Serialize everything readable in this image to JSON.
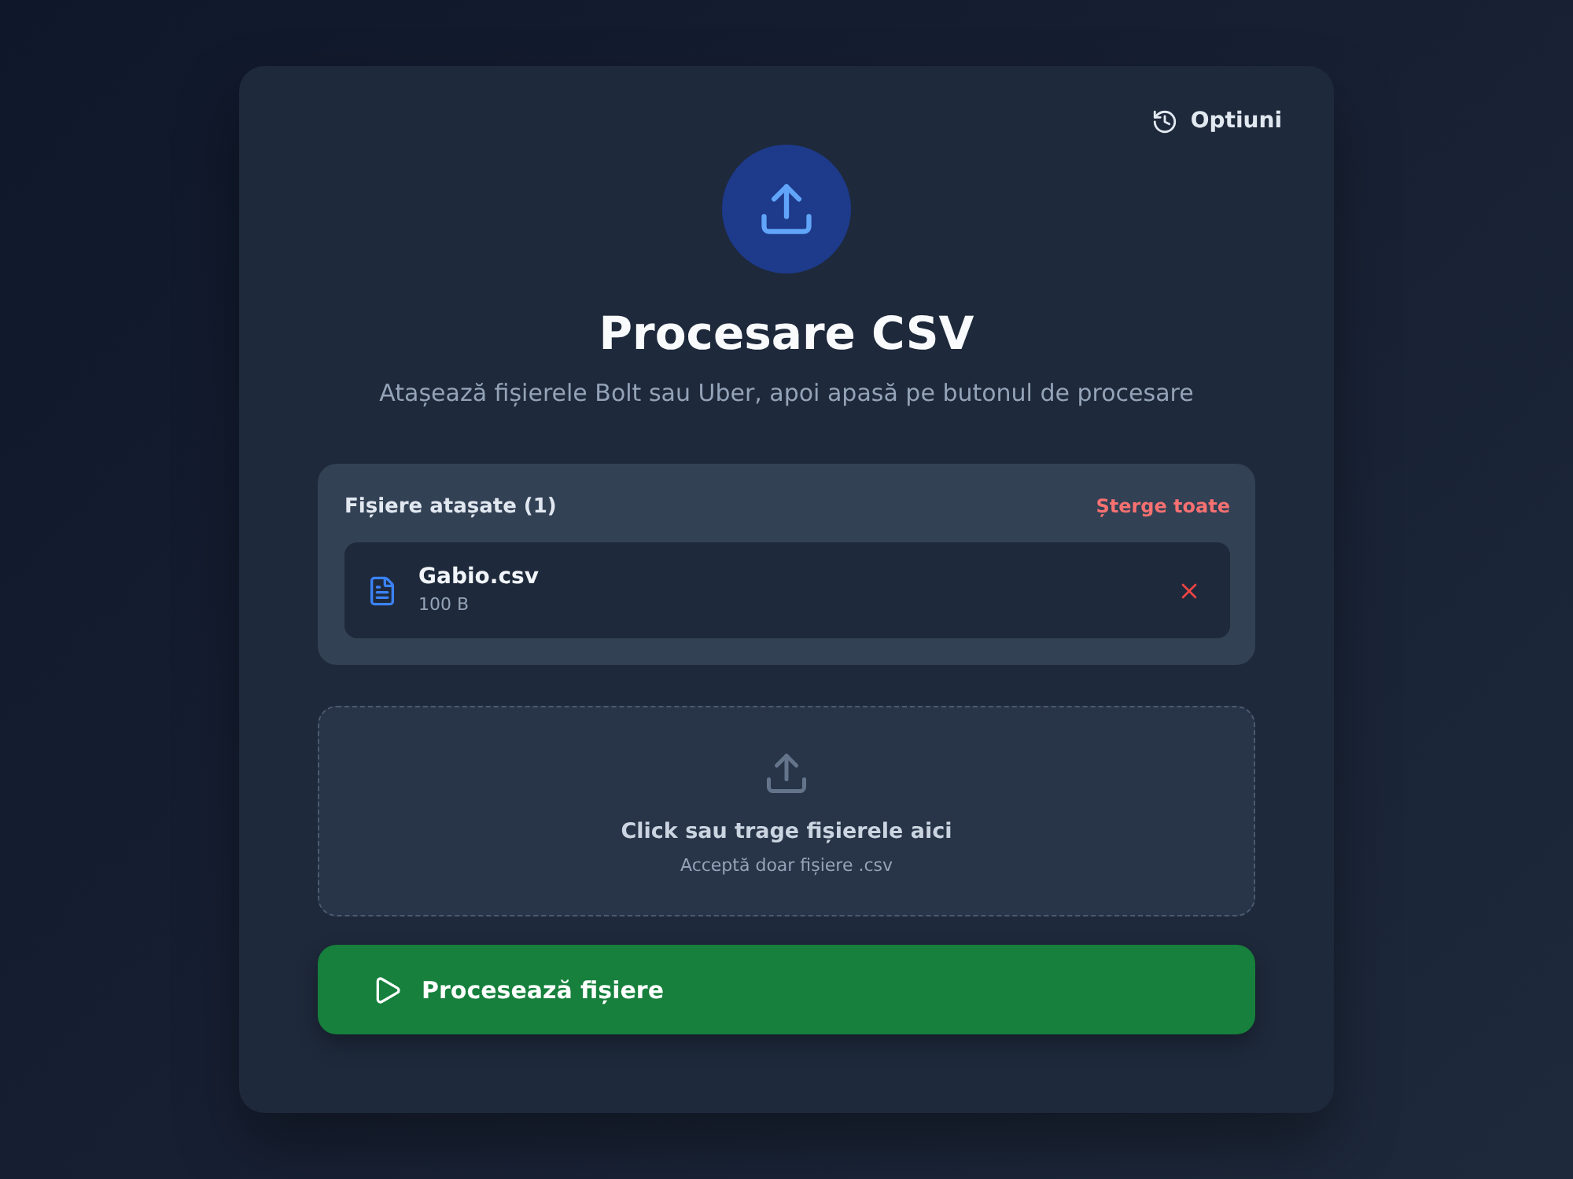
{
  "options_button": {
    "label": "Optiuni"
  },
  "header": {
    "title": "Procesare CSV",
    "subtitle": "Atașează fișierele Bolt sau Uber, apoi apasă pe butonul de procesare"
  },
  "attached_files": {
    "title": "Fișiere atașate (1)",
    "clear_all": "Șterge toate",
    "files": [
      {
        "name": "Gabio.csv",
        "size": "100 B"
      }
    ]
  },
  "drop_zone": {
    "label": "Click sau trage fișierele aici",
    "hint": "Acceptă doar fișiere .csv"
  },
  "process_button": {
    "label": "Procesează fișiere"
  }
}
